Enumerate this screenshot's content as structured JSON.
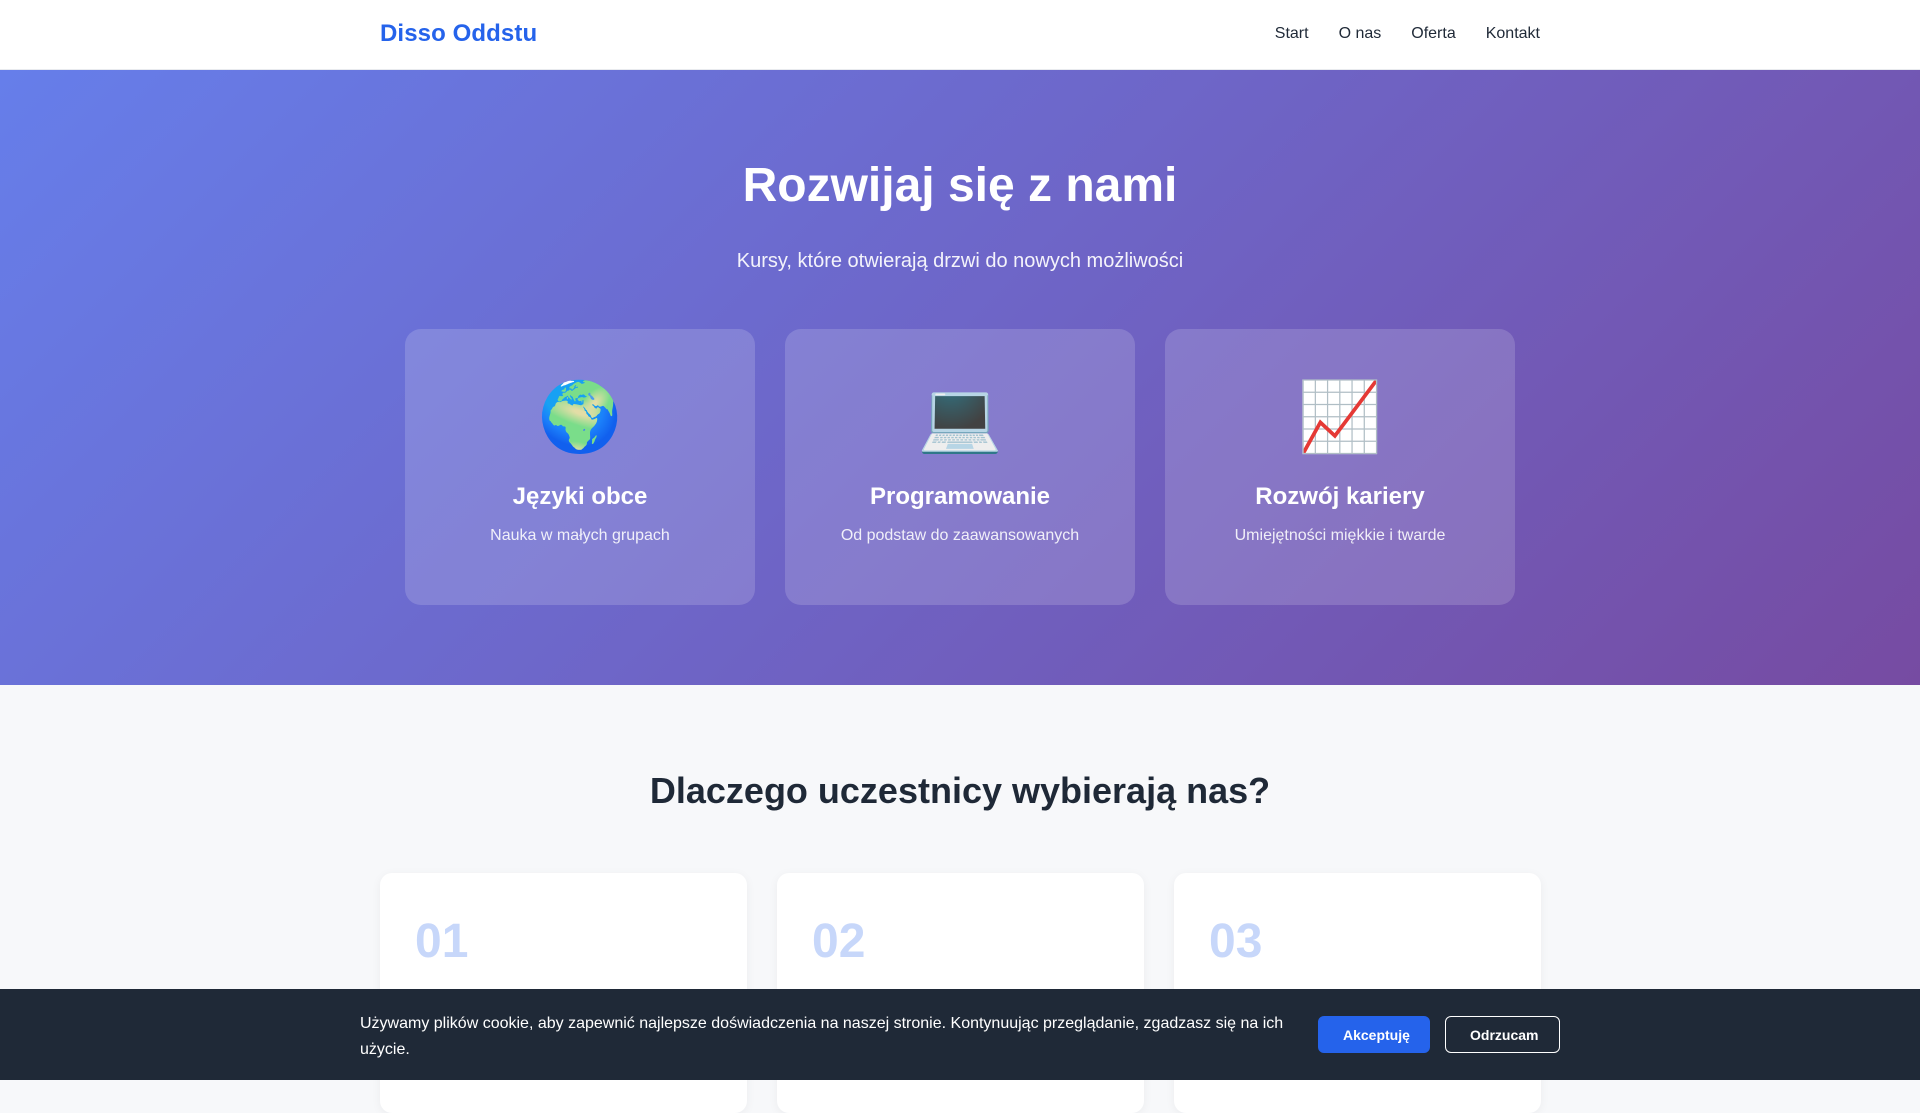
{
  "header": {
    "brand": "Disso Oddstu",
    "nav": [
      "Start",
      "O nas",
      "Oferta",
      "Kontakt"
    ]
  },
  "hero": {
    "title": "Rozwijaj się z nami",
    "subtitle": "Kursy, które otwierają drzwi do nowych możliwości",
    "cards": [
      {
        "icon": "globe-icon",
        "glyph": "🌍",
        "title": "Języki obce",
        "desc": "Nauka w małych grupach"
      },
      {
        "icon": "laptop-icon",
        "glyph": "💻",
        "title": "Programowanie",
        "desc": "Od podstaw do zaawansowanych"
      },
      {
        "icon": "chart-increasing-icon",
        "glyph": "📈",
        "title": "Rozwój kariery",
        "desc": "Umiejętności miękkie i twarde"
      }
    ]
  },
  "why": {
    "title": "Dlaczego uczestnicy wybierają nas?",
    "features": [
      {
        "number": "01"
      },
      {
        "number": "02"
      },
      {
        "number": "03"
      }
    ]
  },
  "cookie": {
    "text": "Używamy plików cookie, aby zapewnić najlepsze doświadczenia na naszej stronie. Kontynuując przeglądanie, zgadzasz się na ich użycie.",
    "accept": "Akceptuję",
    "reject": "Odrzucam"
  },
  "colors": {
    "brand": "#2563eb",
    "hero_gradient_start": "#667eea",
    "hero_gradient_end": "#764ba2",
    "cookie_background": "#1f2937"
  }
}
